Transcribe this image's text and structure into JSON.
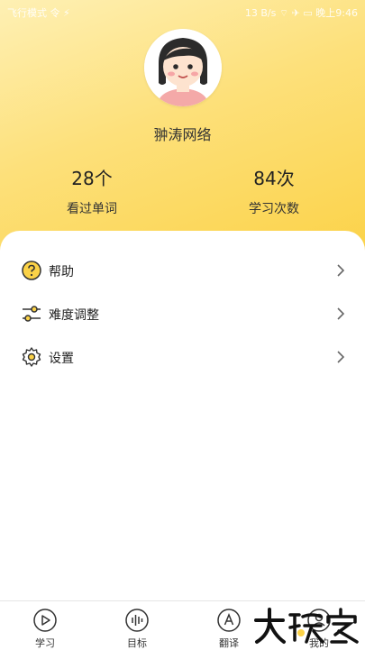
{
  "status_bar": {
    "left": "飞行模式 令 ⚡",
    "right": "13 B/s ⌔ ✈ ▭ 晚上9:46"
  },
  "profile": {
    "name": "翀涛网络"
  },
  "stats": [
    {
      "value": "28个",
      "label": "看过单词"
    },
    {
      "value": "84次",
      "label": "学习次数"
    }
  ],
  "menu": [
    {
      "label": "帮助",
      "icon": "help-icon"
    },
    {
      "label": "难度调整",
      "icon": "sliders-icon"
    },
    {
      "label": "设置",
      "icon": "gear-icon"
    }
  ],
  "tabs": [
    {
      "label": "学习",
      "icon": "play-icon"
    },
    {
      "label": "目标",
      "icon": "waveform-icon"
    },
    {
      "label": "翻译",
      "icon": "translate-icon"
    },
    {
      "label": "我的",
      "icon": "profile-icon"
    }
  ],
  "watermark": "大玩家",
  "colors": {
    "accent": "#fbd247",
    "accent_light": "#fef0b4"
  }
}
